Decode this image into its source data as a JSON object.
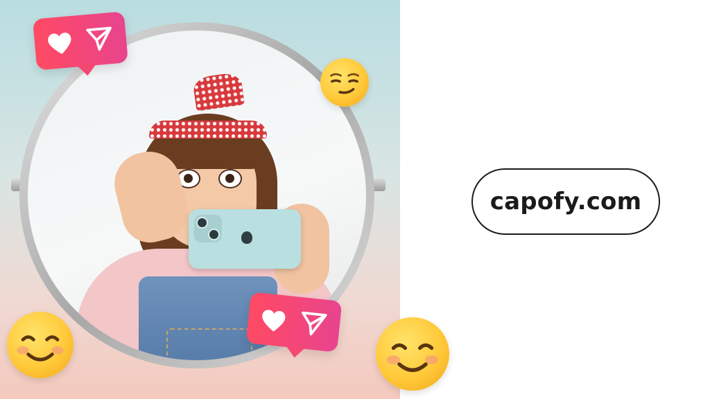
{
  "brand": {
    "domain": "capofy.com",
    "text_color": "#1b1b1b",
    "pill_border_color": "#1b1b1b"
  },
  "hero": {
    "reaction_bubbles": [
      {
        "icons": [
          "heart-icon",
          "send-icon"
        ],
        "color": "#ff4a63"
      },
      {
        "icons": [
          "heart-icon",
          "send-icon"
        ],
        "color": "#ff4a63"
      }
    ],
    "emojis": [
      "smirking-face-emoji",
      "smiling-face-emoji",
      "smiling-face-emoji"
    ],
    "background_colors": [
      "#b9dde1",
      "#f4c9be"
    ]
  }
}
